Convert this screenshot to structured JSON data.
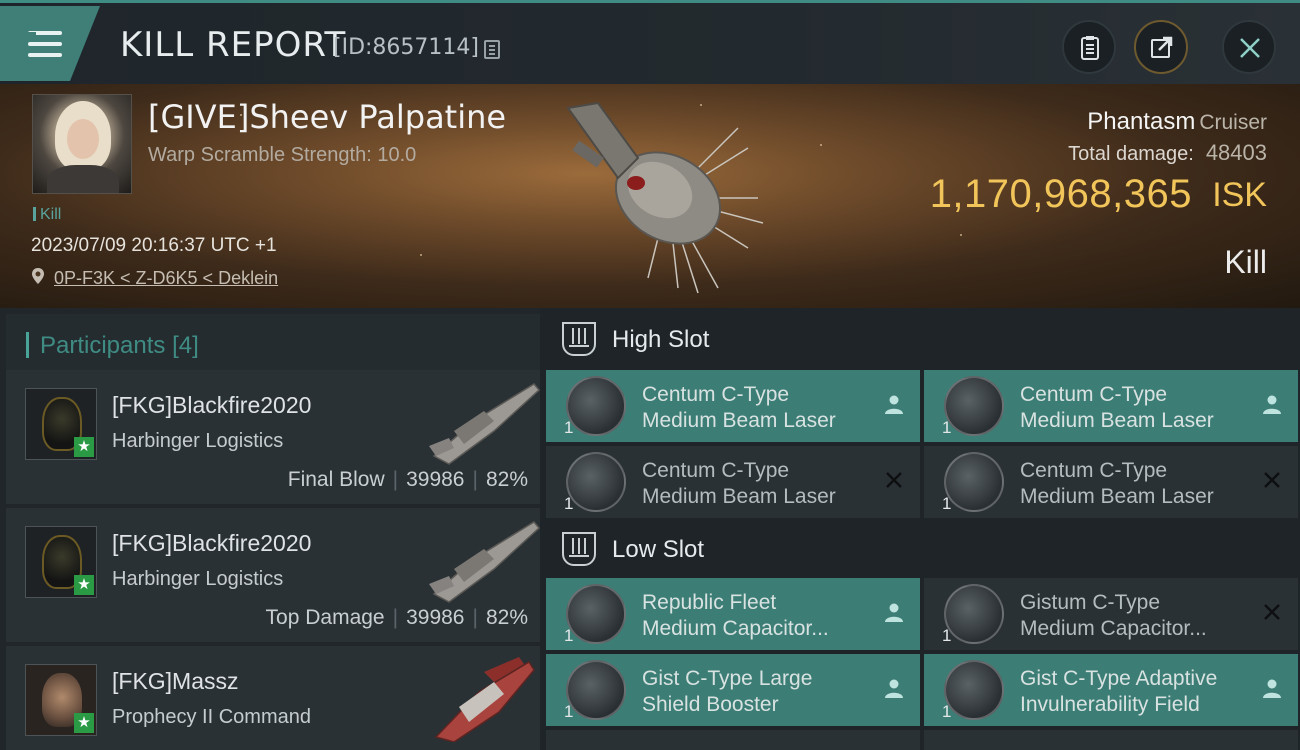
{
  "header": {
    "title": "KILL REPORT",
    "kill_id": "[ID:8657114]"
  },
  "victim": {
    "name": "[GIVE]Sheev Palpatine",
    "warp_scramble": "Warp Scramble Strength: 10.0",
    "tag": "Kill",
    "datetime": "2023/07/09 20:16:37 UTC +1",
    "location": "0P-F3K < Z-D6K5 < Deklein",
    "ship": "Phantasm",
    "ship_class": "Cruiser",
    "total_damage_label": "Total damage:",
    "total_damage": "48403",
    "isk_value": "1,170,968,365",
    "isk_unit": "ISK",
    "result": "Kill"
  },
  "participants": {
    "title": "Participants",
    "count": "[4]",
    "rows": [
      {
        "name": "[FKG]Blackfire2020",
        "ship": "Harbinger Logistics",
        "stat_label": "Final Blow",
        "damage": "39986",
        "percent": "82%"
      },
      {
        "name": "[FKG]Blackfire2020",
        "ship": "Harbinger Logistics",
        "stat_label": "Top Damage",
        "damage": "39986",
        "percent": "82%"
      },
      {
        "name": "[FKG]Massz",
        "ship": "Prophecy II Command",
        "stat_label": "",
        "damage": "",
        "percent": ""
      }
    ]
  },
  "fitting": {
    "high_slot_label": "High Slot",
    "low_slot_label": "Low Slot",
    "high": [
      {
        "line1": "Centum C-Type",
        "line2": "Medium Beam Laser",
        "qty": "1",
        "status": "dropped"
      },
      {
        "line1": "Centum C-Type",
        "line2": "Medium Beam Laser",
        "qty": "1",
        "status": "dropped"
      },
      {
        "line1": "Centum C-Type",
        "line2": "Medium Beam Laser",
        "qty": "1",
        "status": "destroyed"
      },
      {
        "line1": "Centum C-Type",
        "line2": "Medium Beam Laser",
        "qty": "1",
        "status": "destroyed"
      }
    ],
    "low": [
      {
        "line1": "Republic Fleet",
        "line2": "Medium Capacitor...",
        "qty": "1",
        "status": "dropped"
      },
      {
        "line1": "Gistum C-Type",
        "line2": "Medium Capacitor...",
        "qty": "1",
        "status": "destroyed"
      },
      {
        "line1": "Gist C-Type Large",
        "line2": "Shield Booster",
        "qty": "1",
        "status": "dropped"
      },
      {
        "line1": "Gist C-Type Adaptive",
        "line2": "Invulnerability Field",
        "qty": "1",
        "status": "dropped"
      }
    ]
  },
  "colors": {
    "accent": "#3f8c84",
    "isk_gold": "#f2c55a",
    "dropped_bg": "#3c7d75",
    "destroyed_bg": "#2a3135"
  }
}
